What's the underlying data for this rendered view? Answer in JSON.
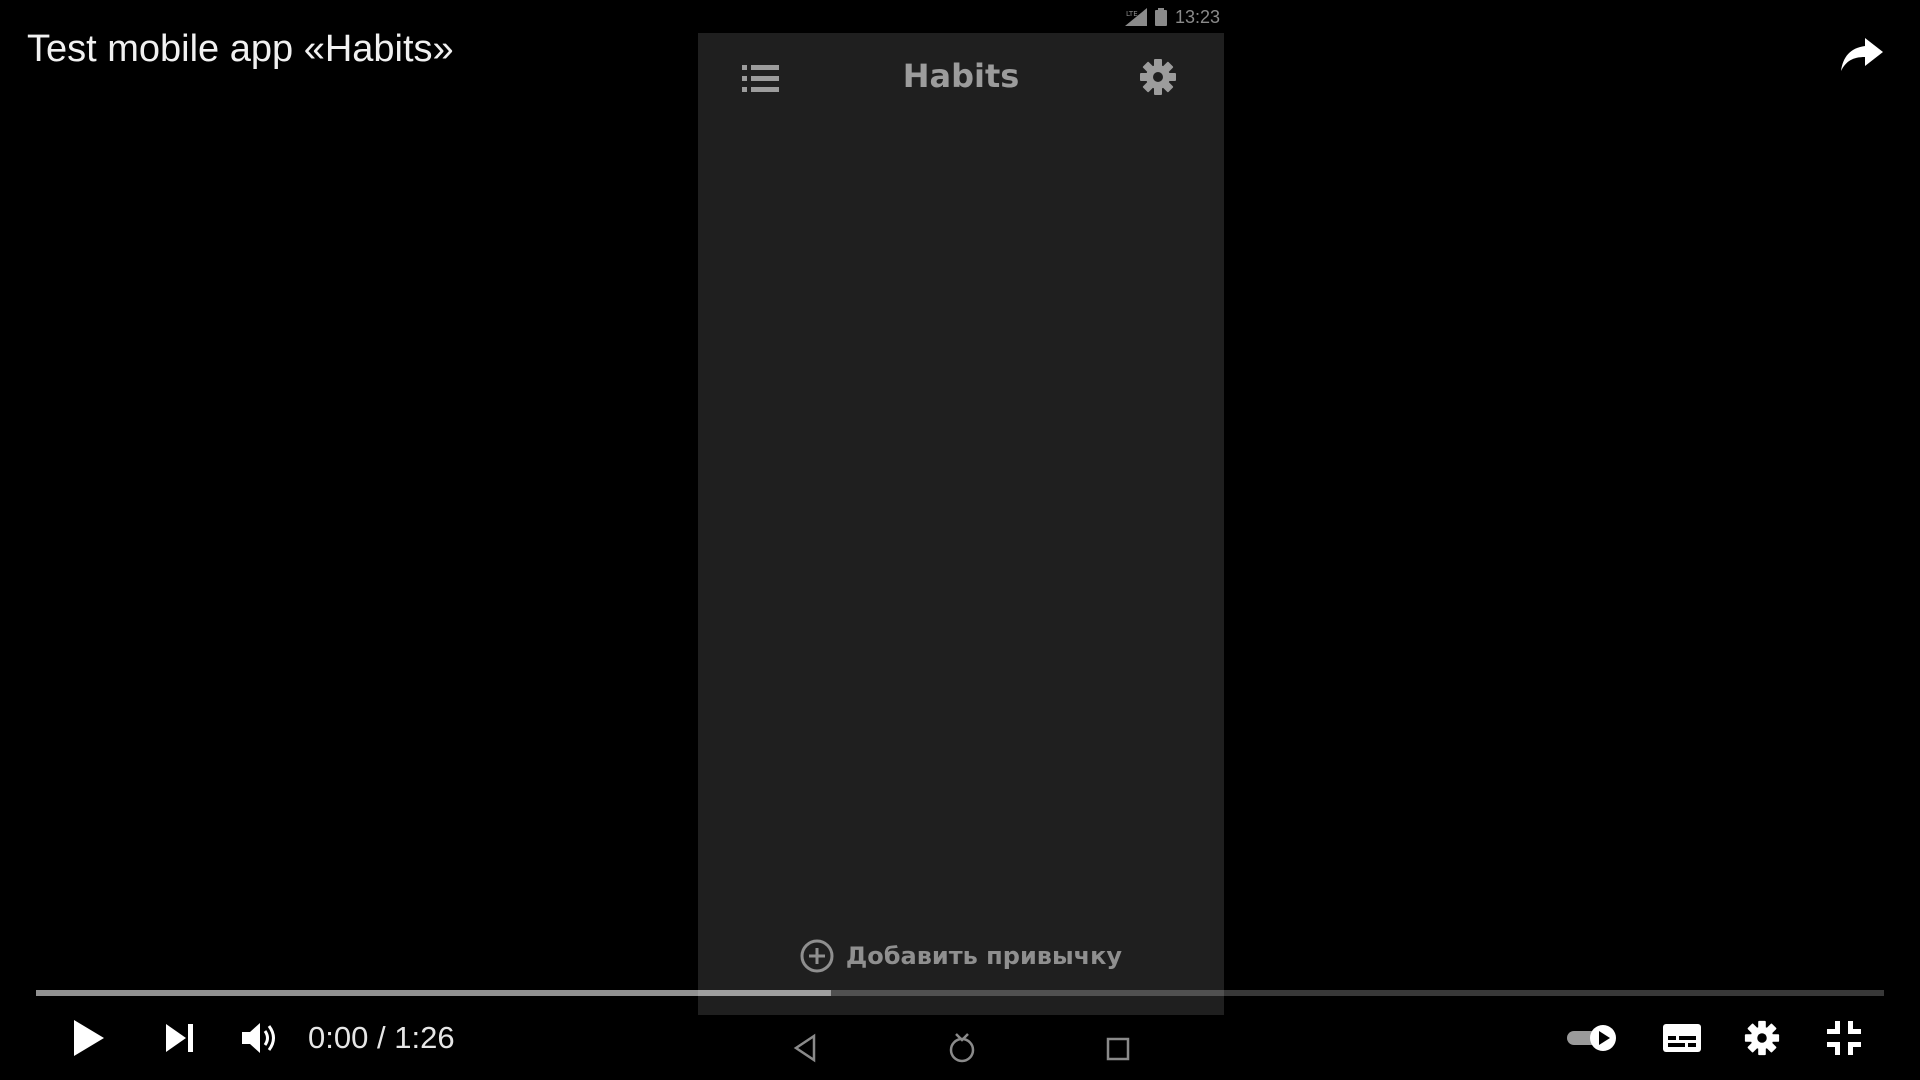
{
  "video": {
    "title": "Test mobile app «Habits»",
    "current_time": "0:00",
    "time_separator": "/",
    "duration": "1:26",
    "buffered_fraction": 0.43
  },
  "status_bar": {
    "time": "13:23",
    "network": "LTE"
  },
  "app": {
    "title": "Habits",
    "add_habit_label": "Добавить привычку"
  },
  "controls": {
    "play": "play-icon",
    "next": "next-icon",
    "volume": "volume-icon",
    "autoplay": "autoplay-toggle-icon",
    "subtitles": "subtitles-icon",
    "settings": "gear-icon",
    "exit_fullscreen": "exit-fullscreen-icon"
  },
  "colors": {
    "background": "#000000",
    "phone_background": "#1f1f1f",
    "text": "#ffffff"
  }
}
